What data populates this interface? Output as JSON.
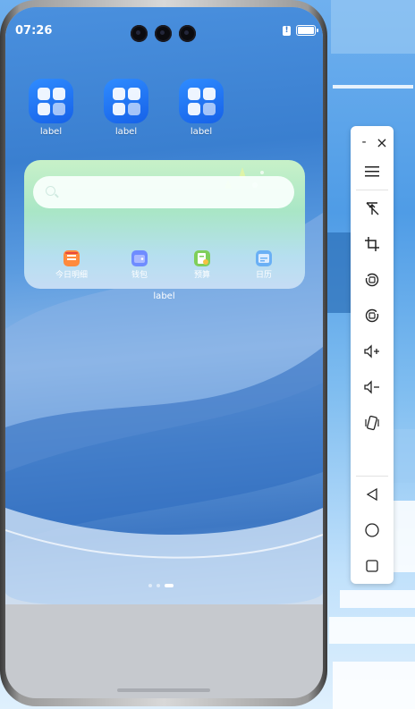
{
  "status_bar": {
    "time": "07:26",
    "alert_glyph": "!"
  },
  "home_apps": [
    {
      "label": "label"
    },
    {
      "label": "label"
    },
    {
      "label": "label"
    }
  ],
  "widget": {
    "search_placeholder": "",
    "shortcuts": [
      {
        "label": "今日明细",
        "icon": "receipt-icon",
        "color": "#ff8a3d"
      },
      {
        "label": "钱包",
        "icon": "wallet-icon",
        "color": "#6f8cff"
      },
      {
        "label": "预算",
        "icon": "budget-icon",
        "color": "#7fcf5a"
      },
      {
        "label": "日历",
        "icon": "calendar-icon",
        "color": "#6ab0f5"
      }
    ],
    "label": "label"
  },
  "page_indicator": {
    "count": 3,
    "active_index": 2
  },
  "toolbar": {
    "minimize_glyph": "-",
    "close_glyph": "×",
    "items": [
      {
        "name": "menu-icon"
      },
      {
        "name": "pin-off-icon"
      },
      {
        "name": "crop-icon"
      },
      {
        "name": "rotate-left-icon"
      },
      {
        "name": "rotate-right-icon"
      },
      {
        "name": "volume-up-icon"
      },
      {
        "name": "volume-down-icon"
      },
      {
        "name": "shake-icon"
      },
      {
        "name": "back-icon"
      },
      {
        "name": "home-icon"
      },
      {
        "name": "recents-icon"
      }
    ]
  },
  "colors": {
    "accent": "#1b6cf0",
    "widget_green": "#a9e6c6"
  }
}
